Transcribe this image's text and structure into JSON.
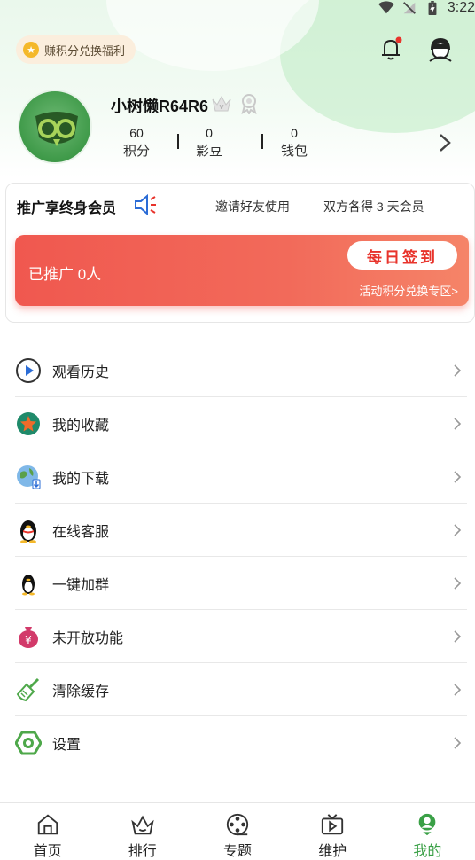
{
  "status_bar": {
    "time": "3:22"
  },
  "top": {
    "points_pill": "赚积分兑换福利"
  },
  "profile": {
    "username": "小树懒R64R6",
    "stats": [
      {
        "value": "60",
        "label": "积分"
      },
      {
        "value": "0",
        "label": "影豆"
      },
      {
        "value": "0",
        "label": "钱包"
      }
    ]
  },
  "promo": {
    "title": "推广享终身会员",
    "invite": "邀请好友使用",
    "both_get": "双方各得 3 天会员",
    "promoted": "已推广 0人",
    "signin": "每日签到",
    "exchange": "活动积分兑换专区>"
  },
  "menu": [
    {
      "label": "观看历史",
      "icon": "play-history-icon"
    },
    {
      "label": "我的收藏",
      "icon": "favorite-star-icon"
    },
    {
      "label": "我的下载",
      "icon": "download-globe-icon"
    },
    {
      "label": "在线客服",
      "icon": "qq-penguin-icon"
    },
    {
      "label": "一键加群",
      "icon": "qq-penguin-group-icon"
    },
    {
      "label": "未开放功能",
      "icon": "money-bag-icon"
    },
    {
      "label": "清除缓存",
      "icon": "broom-icon"
    },
    {
      "label": "设置",
      "icon": "hexagon-settings-icon"
    }
  ],
  "bottom_nav": [
    {
      "label": "首页",
      "icon": "home-icon"
    },
    {
      "label": "排行",
      "icon": "ranking-crown-icon"
    },
    {
      "label": "专题",
      "icon": "film-reel-icon"
    },
    {
      "label": "维护",
      "icon": "tv-play-icon"
    },
    {
      "label": "我的",
      "icon": "profile-icon",
      "active": true
    }
  ],
  "colors": {
    "accent_green": "#3aa046",
    "promo_red": "#f0584f",
    "signin_text": "#e8332b"
  }
}
